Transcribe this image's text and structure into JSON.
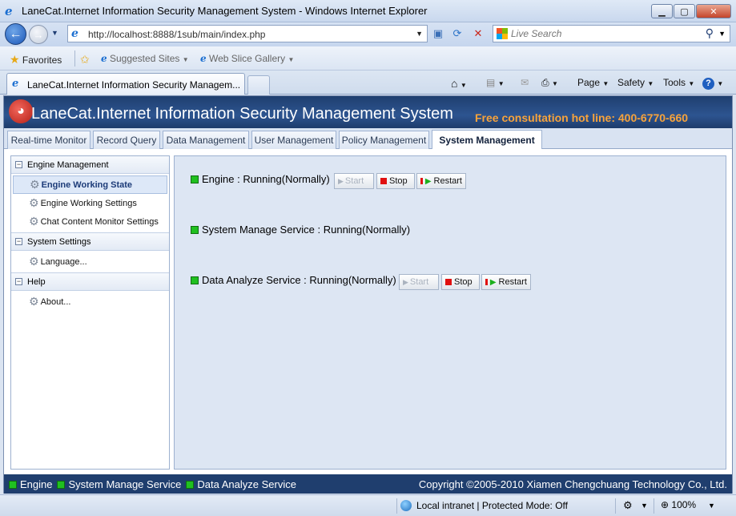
{
  "window": {
    "title": "LaneCat.Internet Information Security Management System - Windows Internet Explorer",
    "minimize_icon": "minimize-icon",
    "maximize_icon": "maximize-icon",
    "close_icon": "close-icon"
  },
  "addressbar": {
    "url": "http://localhost:8888/1sub/main/index.php",
    "search_placeholder": "Live Search"
  },
  "favorites_bar": {
    "favorites_label": "Favorites",
    "suggested_sites": "Suggested Sites",
    "web_slice_gallery": "Web Slice Gallery"
  },
  "tabs": {
    "active_tab": "LaneCat.Internet Information Security Managem..."
  },
  "command_bar": {
    "page": "Page",
    "safety": "Safety",
    "tools": "Tools"
  },
  "app": {
    "title": "LaneCat.Internet Information Security Management System",
    "hotline": "Free consultation hot line: 400-6770-660",
    "menu": [
      {
        "label": "Real-time Monitor"
      },
      {
        "label": "Record Query"
      },
      {
        "label": "Data Management"
      },
      {
        "label": "User Management"
      },
      {
        "label": "Policy Management"
      },
      {
        "label": "System Management",
        "active": true
      }
    ]
  },
  "sidebar": {
    "groups": [
      {
        "label": "Engine Management",
        "items": [
          {
            "label": "Engine Working State",
            "active": true
          },
          {
            "label": "Engine Working Settings"
          },
          {
            "label": "Chat Content Monitor Settings"
          }
        ]
      },
      {
        "label": "System Settings",
        "items": [
          {
            "label": "Language..."
          }
        ]
      },
      {
        "label": "Help",
        "items": [
          {
            "label": "About..."
          }
        ]
      }
    ]
  },
  "services": [
    {
      "label": "Engine : Running(Normally)",
      "buttons": {
        "start": "Start",
        "stop": "Stop",
        "restart": "Restart"
      }
    },
    {
      "label": "System Manage Service : Running(Normally)"
    },
    {
      "label": "Data Analyze Service : Running(Normally)",
      "buttons": {
        "start": "Start",
        "stop": "Stop",
        "restart": "Restart"
      }
    }
  ],
  "statusbar": {
    "engine": "Engine",
    "system_manage": "System Manage Service",
    "data_analyze": "Data Analyze Service",
    "copyright": "Copyright ©2005-2010 Xiamen Chengchuang Technology Co., Ltd."
  },
  "ie_status": {
    "zone": "Local intranet | Protected Mode: Off",
    "zoom": "100%"
  },
  "colors": {
    "banner": "#2d5490",
    "hotline": "#f7a33b",
    "status_led": "#20c020",
    "stop": "#e01010"
  }
}
